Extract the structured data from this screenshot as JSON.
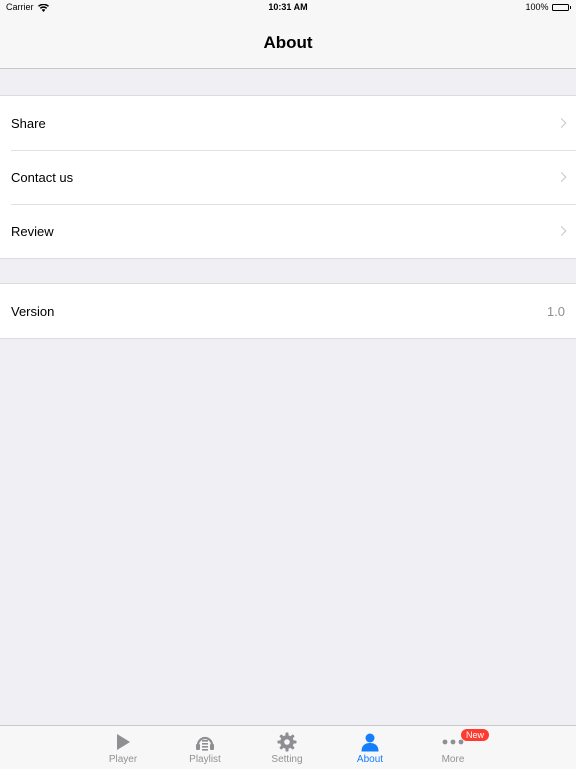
{
  "status_bar": {
    "carrier": "Carrier",
    "time": "10:31 AM",
    "battery": "100%",
    "wifi_icon": "wifi-icon",
    "battery_icon": "battery-icon"
  },
  "nav": {
    "title": "About"
  },
  "sections": [
    {
      "rows": [
        {
          "label": "Share",
          "accessory": "chevron-right-icon"
        },
        {
          "label": "Contact us",
          "accessory": "chevron-right-icon"
        },
        {
          "label": "Review",
          "accessory": "chevron-right-icon"
        }
      ]
    },
    {
      "rows": [
        {
          "label": "Version",
          "value": "1.0"
        }
      ]
    }
  ],
  "tab_bar": {
    "tabs": [
      {
        "label": "Player",
        "icon": "play-icon",
        "active": false
      },
      {
        "label": "Playlist",
        "icon": "playlist-icon",
        "active": false
      },
      {
        "label": "Setting",
        "icon": "gear-icon",
        "active": false
      },
      {
        "label": "About",
        "icon": "person-icon",
        "active": true
      },
      {
        "label": "More",
        "icon": "more-dots-icon",
        "active": false,
        "badge": "New"
      }
    ]
  },
  "colors": {
    "accent": "#147efb",
    "badge": "#ff3b30",
    "background": "#efeff4",
    "inactive_tab": "#929292"
  }
}
